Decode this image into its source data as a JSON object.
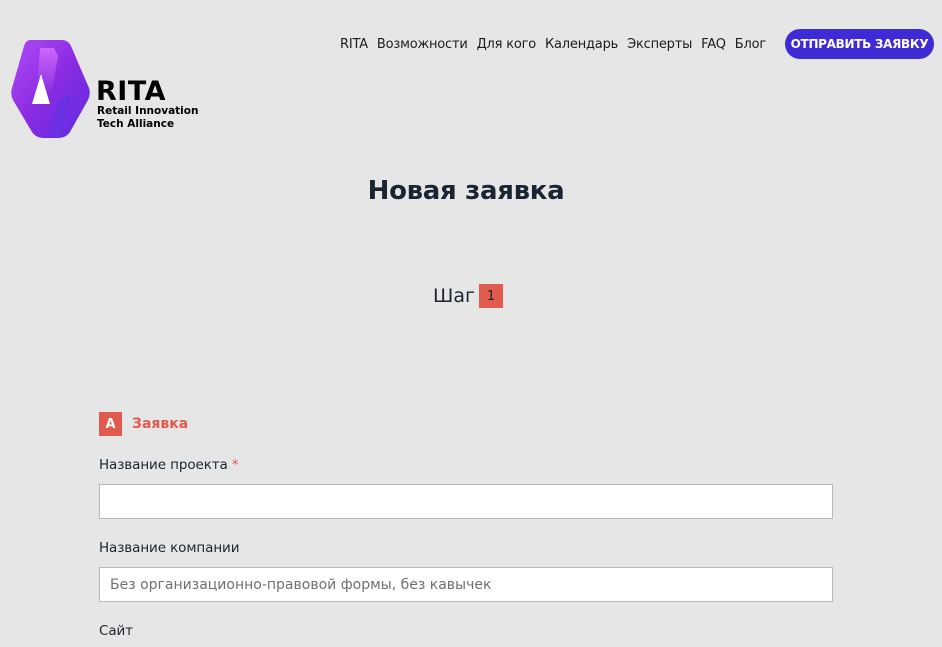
{
  "logo": {
    "title": "RITA",
    "subtitle_line1": "Retail Innovation",
    "subtitle_line2": "Tech Alliance"
  },
  "nav": {
    "items": [
      "RITA",
      "Возможности",
      "Для кого",
      "Календарь",
      "Эксперты",
      "FAQ",
      "Блог"
    ],
    "cta_label": "ОТПРАВИТЬ ЗАЯВКУ"
  },
  "page": {
    "title": "Новая заявка",
    "step_label": "Шаг",
    "step_number": "1"
  },
  "form": {
    "section_badge": "A",
    "section_title": "Заявка",
    "project_name": {
      "label": "Название проекта",
      "required_mark": "*",
      "value": "",
      "placeholder": ""
    },
    "company_name": {
      "label": "Название компании",
      "value": "",
      "placeholder": "Без организационно-правовой формы, без кавычек"
    },
    "site": {
      "label": "Сайт"
    }
  },
  "colors": {
    "background": "#e6e6e6",
    "accent": "#e05a4e",
    "cta": "#3f2bd6",
    "logo_purple": "#8a2be2"
  }
}
